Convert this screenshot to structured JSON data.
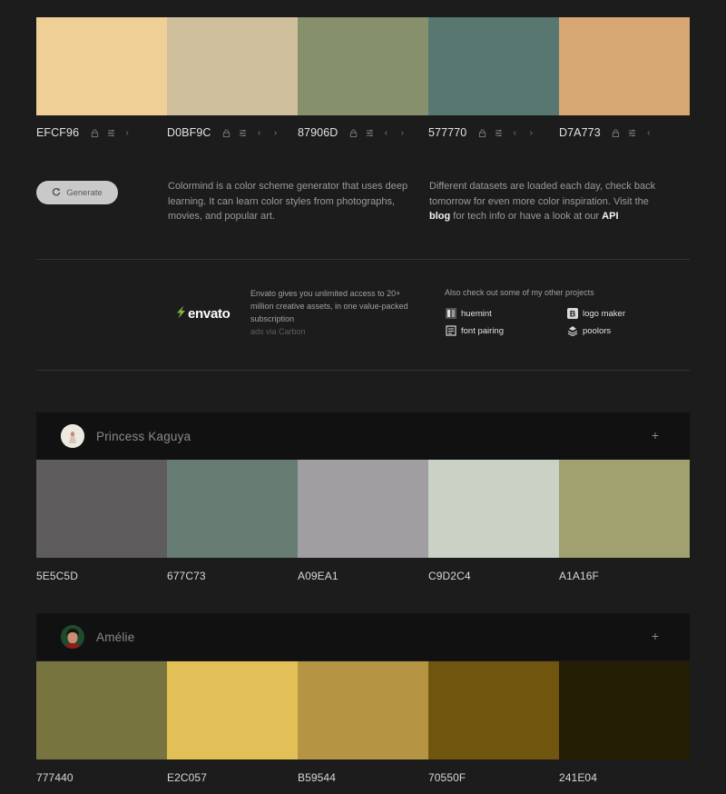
{
  "main_palette": {
    "colors": [
      {
        "hex": "EFCF96",
        "color": "#EFCF96"
      },
      {
        "hex": "D0BF9C",
        "color": "#D0BF9C"
      },
      {
        "hex": "87906D",
        "color": "#87906D"
      },
      {
        "hex": "577770",
        "color": "#577770"
      },
      {
        "hex": "D7A773",
        "color": "#D7A773"
      }
    ],
    "icons": [
      "lock-icon",
      "sliders-icon",
      "chevron-left-icon",
      "chevron-right-icon"
    ]
  },
  "generate_button": {
    "label": "Generate",
    "icon": "refresh-icon"
  },
  "description_left": "Colormind is a color scheme generator that uses deep learning. It can learn color styles from photographs, movies, and popular art.",
  "description_right": {
    "text_1": "Different datasets are loaded each day, check back tomorrow for even more color inspiration. Visit the",
    "link_blog": "blog",
    "text_2": "for tech info or have a look at our",
    "link_api": "API"
  },
  "ad": {
    "brand": "envato",
    "brand_color": "#82B541",
    "text": "Envato gives you unlimited access to 20+ million creative assets, in one value-packed subscription",
    "via": "ads via Carbon"
  },
  "projects": {
    "title": "Also check out some of my other projects",
    "items": [
      {
        "label": "huemint",
        "icon": "huemint-icon"
      },
      {
        "label": "logo maker",
        "icon": "logo-maker-icon"
      },
      {
        "label": "font pairing",
        "icon": "font-pairing-icon"
      },
      {
        "label": "poolors",
        "icon": "poolors-icon"
      }
    ]
  },
  "cards": [
    {
      "name": "Princess Kaguya",
      "add_label": "+",
      "colors": [
        {
          "hex": "5E5C5D",
          "color": "#5E5C5D"
        },
        {
          "hex": "677C73",
          "color": "#677C73"
        },
        {
          "hex": "A09EA1",
          "color": "#A09EA1"
        },
        {
          "hex": "C9D2C4",
          "color": "#C9D2C4"
        },
        {
          "hex": "A1A16F",
          "color": "#A1A16F"
        }
      ]
    },
    {
      "name": "Amélie",
      "add_label": "+",
      "colors": [
        {
          "hex": "777440",
          "color": "#777440"
        },
        {
          "hex": "E2C057",
          "color": "#E2C057"
        },
        {
          "hex": "B59544",
          "color": "#B59544"
        },
        {
          "hex": "70550F",
          "color": "#70550F"
        },
        {
          "hex": "241E04",
          "color": "#241E04"
        }
      ]
    }
  ]
}
